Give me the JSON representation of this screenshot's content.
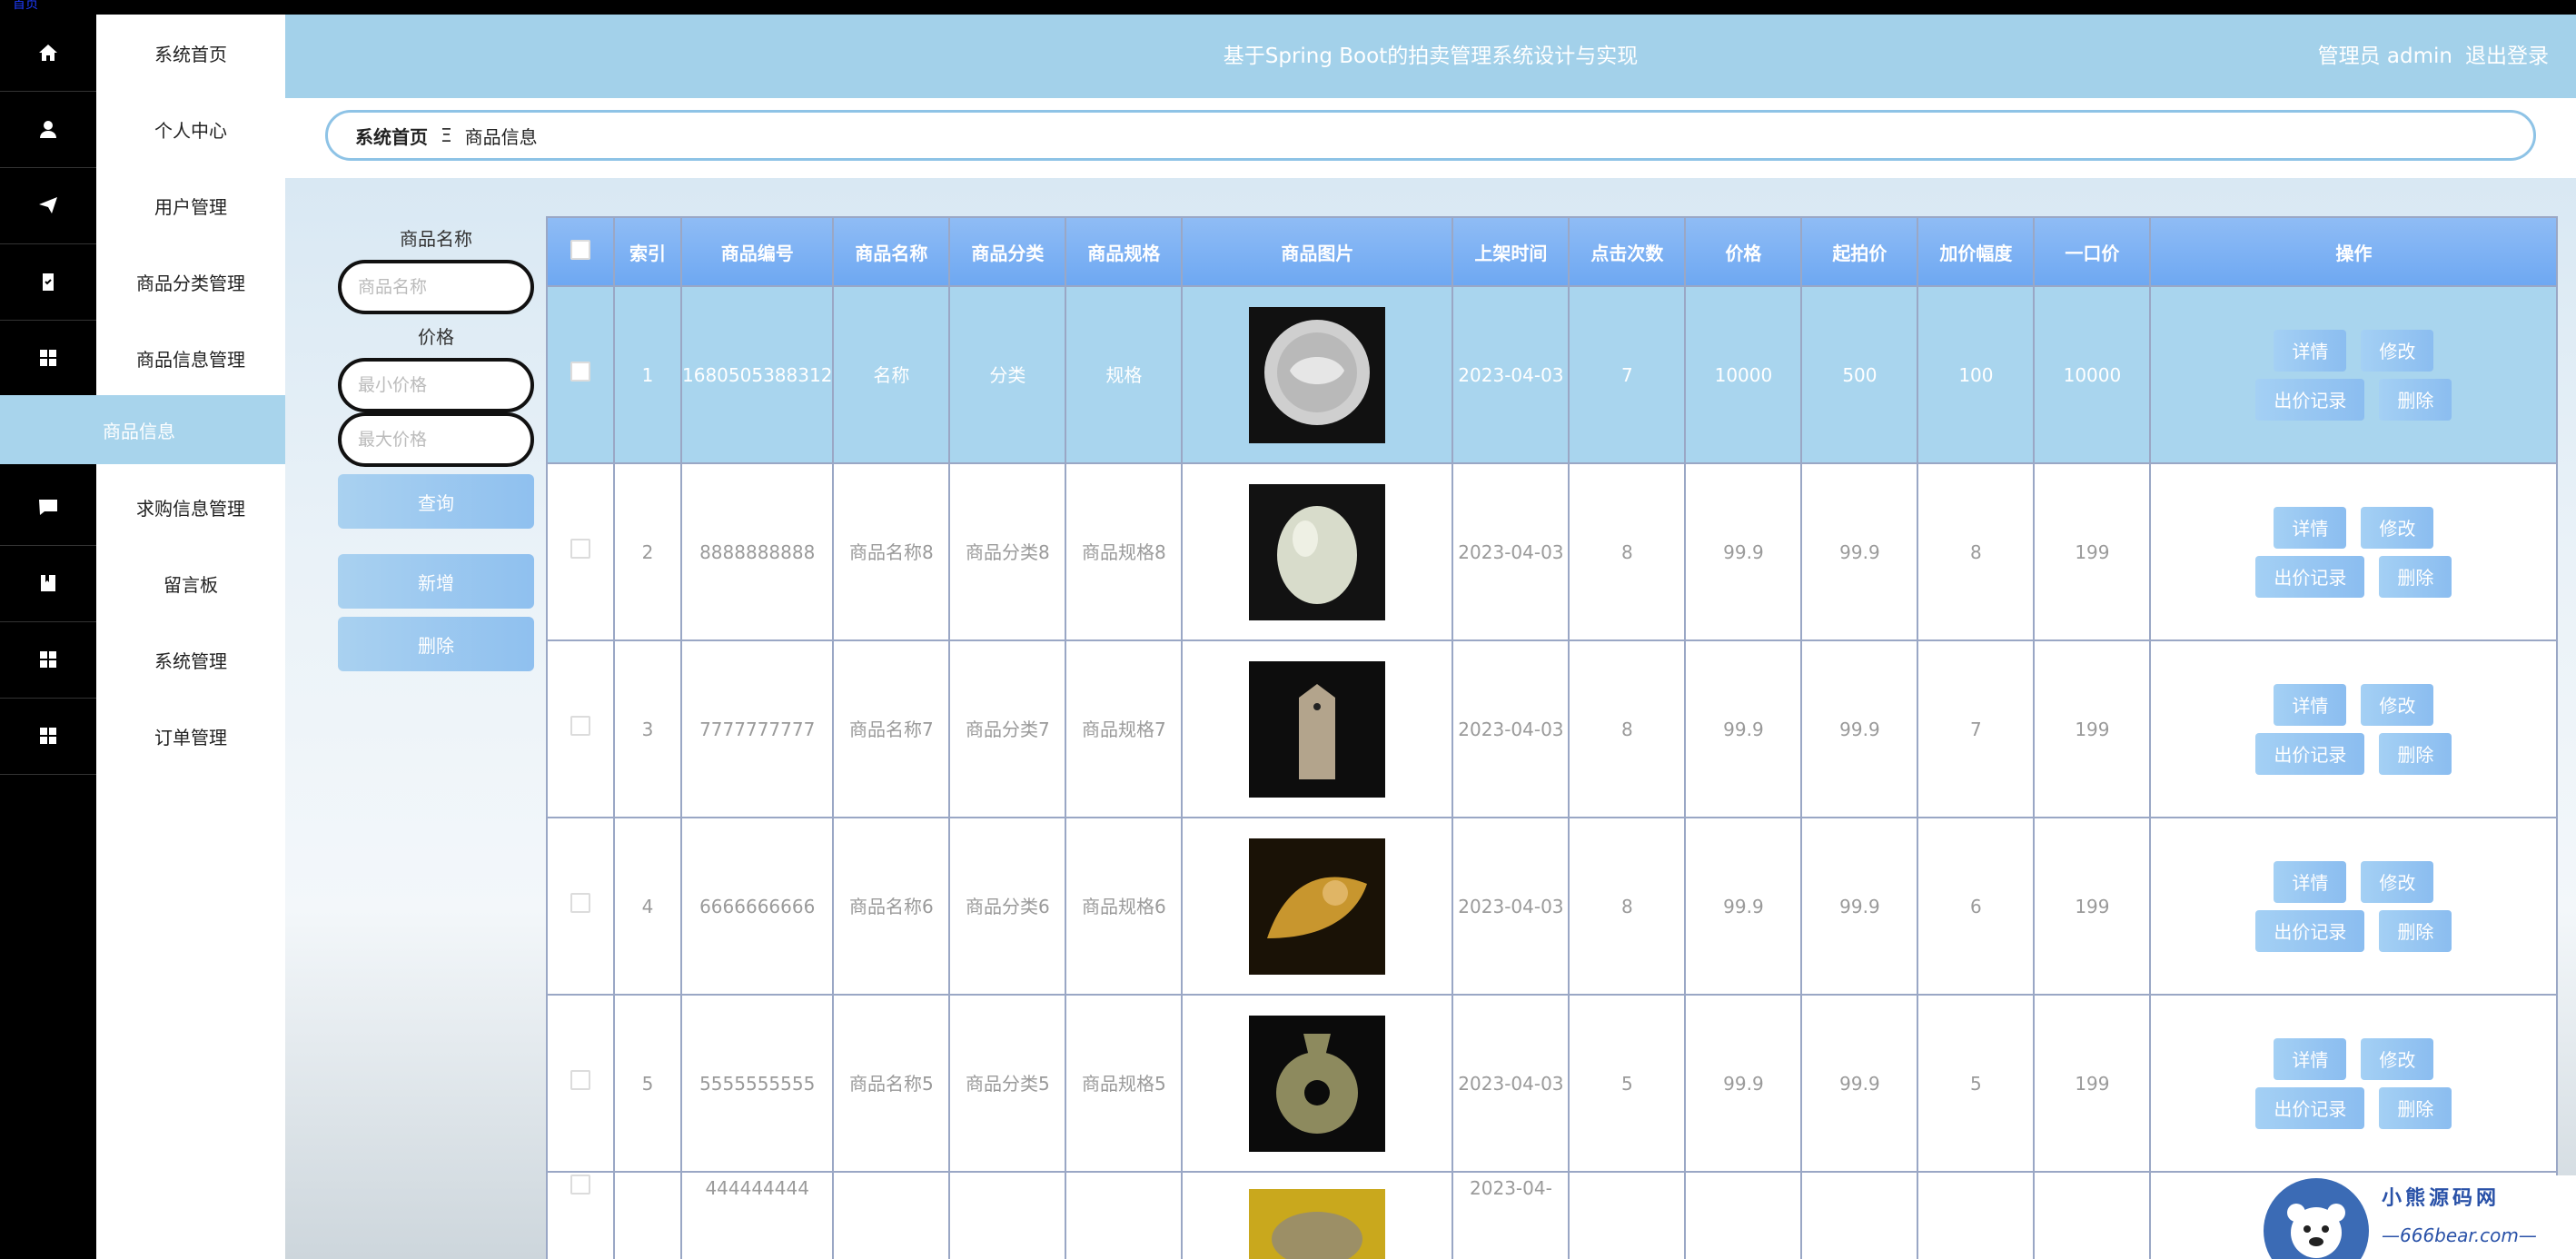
{
  "top_strip_text": "首页",
  "header": {
    "title": "基于Spring Boot的拍卖管理系统设计与实现",
    "user": "管理员 admin",
    "logout": "退出登录"
  },
  "sidebar": {
    "items": [
      {
        "label": "系统首页",
        "icon": "home-icon"
      },
      {
        "label": "个人中心",
        "icon": "user-icon"
      },
      {
        "label": "用户管理",
        "icon": "send-icon"
      },
      {
        "label": "商品分类管理",
        "icon": "clipboard-icon"
      },
      {
        "label": "商品信息管理",
        "icon": "grid-icon"
      },
      {
        "label": "求购信息管理",
        "icon": "chat-icon"
      },
      {
        "label": "留言板",
        "icon": "book-icon"
      },
      {
        "label": "系统管理",
        "icon": "grid-icon"
      },
      {
        "label": "订单管理",
        "icon": "grid-icon"
      }
    ],
    "active_sub": "商品信息"
  },
  "breadcrumb": {
    "home": "系统首页",
    "separator": "Ξ",
    "current": "商品信息"
  },
  "filter": {
    "name_label": "商品名称",
    "name_placeholder": "商品名称",
    "price_label": "价格",
    "min_placeholder": "最小价格",
    "max_placeholder": "最大价格",
    "search_btn": "查询",
    "add_btn": "新增",
    "delete_btn": "删除"
  },
  "table": {
    "headers": [
      "索引",
      "商品编号",
      "商品名称",
      "商品分类",
      "商品规格",
      "商品图片",
      "上架时间",
      "点击次数",
      "价格",
      "起拍价",
      "加价幅度",
      "一口价",
      "操作"
    ],
    "action_labels": {
      "detail": "详情",
      "edit": "修改",
      "bids": "出价记录",
      "delete": "删除"
    },
    "rows": [
      {
        "index": "1",
        "code": "1680505388312",
        "name": "名称",
        "category": "分类",
        "spec": "规格",
        "date": "2023-04-03",
        "clicks": "7",
        "price": "10000",
        "start": "500",
        "step": "100",
        "buyout": "10000",
        "selected": true
      },
      {
        "index": "2",
        "code": "8888888888",
        "name": "商品名称8",
        "category": "商品分类8",
        "spec": "商品规格8",
        "date": "2023-04-03",
        "clicks": "8",
        "price": "99.9",
        "start": "99.9",
        "step": "8",
        "buyout": "199"
      },
      {
        "index": "3",
        "code": "7777777777",
        "name": "商品名称7",
        "category": "商品分类7",
        "spec": "商品规格7",
        "date": "2023-04-03",
        "clicks": "8",
        "price": "99.9",
        "start": "99.9",
        "step": "7",
        "buyout": "199"
      },
      {
        "index": "4",
        "code": "6666666666",
        "name": "商品名称6",
        "category": "商品分类6",
        "spec": "商品规格6",
        "date": "2023-04-03",
        "clicks": "8",
        "price": "99.9",
        "start": "99.9",
        "step": "6",
        "buyout": "199"
      },
      {
        "index": "5",
        "code": "5555555555",
        "name": "商品名称5",
        "category": "商品分类5",
        "spec": "商品规格5",
        "date": "2023-04-03",
        "clicks": "5",
        "price": "99.9",
        "start": "99.9",
        "step": "5",
        "buyout": "199"
      },
      {
        "index": "",
        "code": "444444444",
        "name": "",
        "category": "",
        "spec": "",
        "date": "2023-04-",
        "clicks": "",
        "price": "",
        "start": "",
        "step": "",
        "buyout": ""
      }
    ]
  },
  "watermark": {
    "line1": "小熊源码网",
    "line2": "—666bear.com—"
  }
}
